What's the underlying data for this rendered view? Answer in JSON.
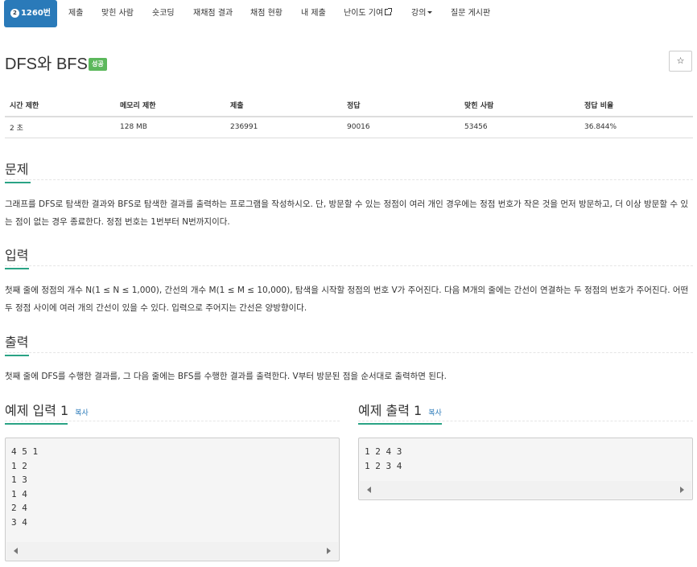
{
  "nav": {
    "tabs": [
      {
        "label": "1260번",
        "tier": "2"
      },
      {
        "label": "제출"
      },
      {
        "label": "맞힌 사람"
      },
      {
        "label": "숏코딩"
      },
      {
        "label": "재채점 결과"
      },
      {
        "label": "채점 현황"
      },
      {
        "label": "내 제출"
      },
      {
        "label": "난이도 기여"
      },
      {
        "label": "강의"
      },
      {
        "label": "질문 게시판"
      }
    ]
  },
  "problem": {
    "title": "DFS와 BFS",
    "status_badge": "성공",
    "star": "☆"
  },
  "info": {
    "headers": [
      "시간 제한",
      "메모리 제한",
      "제출",
      "정답",
      "맞힌 사람",
      "정답 비율"
    ],
    "values": [
      "2 초",
      "128 MB",
      "236991",
      "90016",
      "53456",
      "36.844%"
    ]
  },
  "sections": {
    "problem_heading": "문제",
    "problem_text": "그래프를 DFS로 탐색한 결과와 BFS로 탐색한 결과를 출력하는 프로그램을 작성하시오. 단, 방문할 수 있는 정점이 여러 개인 경우에는 정점 번호가 작은 것을 먼저 방문하고, 더 이상 방문할 수 있는 점이 없는 경우 종료한다. 정점 번호는 1번부터 N번까지이다.",
    "input_heading": "입력",
    "input_text": "첫째 줄에 정점의 개수 N(1 ≤ N ≤ 1,000), 간선의 개수 M(1 ≤ M ≤ 10,000), 탐색을 시작할 정점의 번호 V가 주어진다. 다음 M개의 줄에는 간선이 연결하는 두 정점의 번호가 주어진다. 어떤 두 정점 사이에 여러 개의 간선이 있을 수 있다. 입력으로 주어지는 간선은 양방향이다.",
    "output_heading": "출력",
    "output_text": "첫째 줄에 DFS를 수행한 결과를, 그 다음 줄에는 BFS를 수행한 결과를 출력한다. V부터 방문된 점을 순서대로 출력하면 된다."
  },
  "samples": {
    "input_heading": "예제 입력 1",
    "output_heading": "예제 출력 1",
    "copy_label": "복사",
    "input": "4 5 1\n1 2\n1 3\n1 4\n2 4\n3 4",
    "output": "1 2 4 3\n1 2 3 4"
  }
}
